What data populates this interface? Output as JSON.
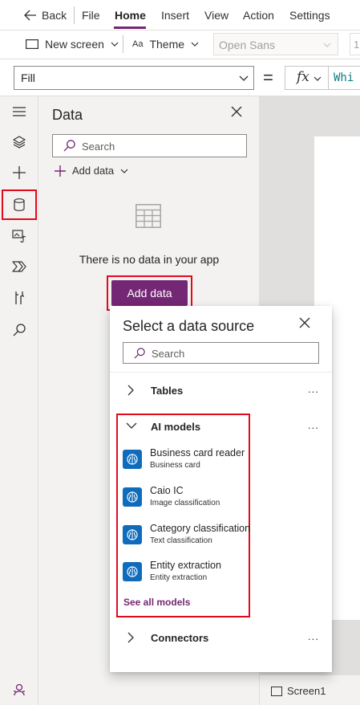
{
  "menubar": {
    "back": "Back",
    "items": [
      "File",
      "Home",
      "Insert",
      "View",
      "Action",
      "Settings"
    ],
    "active": "Home"
  },
  "toolbar": {
    "new_screen": "New screen",
    "theme": "Theme",
    "font": "Open Sans",
    "font_size": "1"
  },
  "formula_bar": {
    "property": "Fill",
    "equals": "=",
    "fx": "fx",
    "formula": "Whi"
  },
  "data_panel": {
    "title": "Data",
    "search_placeholder": "Search",
    "add_data_menu": "Add data",
    "empty_message": "There is no data in your app",
    "add_data_button": "Add data"
  },
  "flyout": {
    "title": "Select a data source",
    "search_placeholder": "Search",
    "sections": {
      "tables": "Tables",
      "ai_models": "AI models",
      "connectors": "Connectors"
    },
    "more": "...",
    "models": [
      {
        "name": "Business card reader",
        "type": "Business card"
      },
      {
        "name": "Caio IC",
        "type": "Image classification"
      },
      {
        "name": "Category classification",
        "type": "Text classification"
      },
      {
        "name": "Entity extraction",
        "type": "Entity extraction"
      }
    ],
    "see_all": "See all models"
  },
  "status": {
    "screen_tab": "Screen1"
  },
  "colors": {
    "accent": "#742774",
    "highlight": "#e00b1c",
    "model_icon": "#0f6cbd",
    "formula_text": "#0e7c86"
  }
}
